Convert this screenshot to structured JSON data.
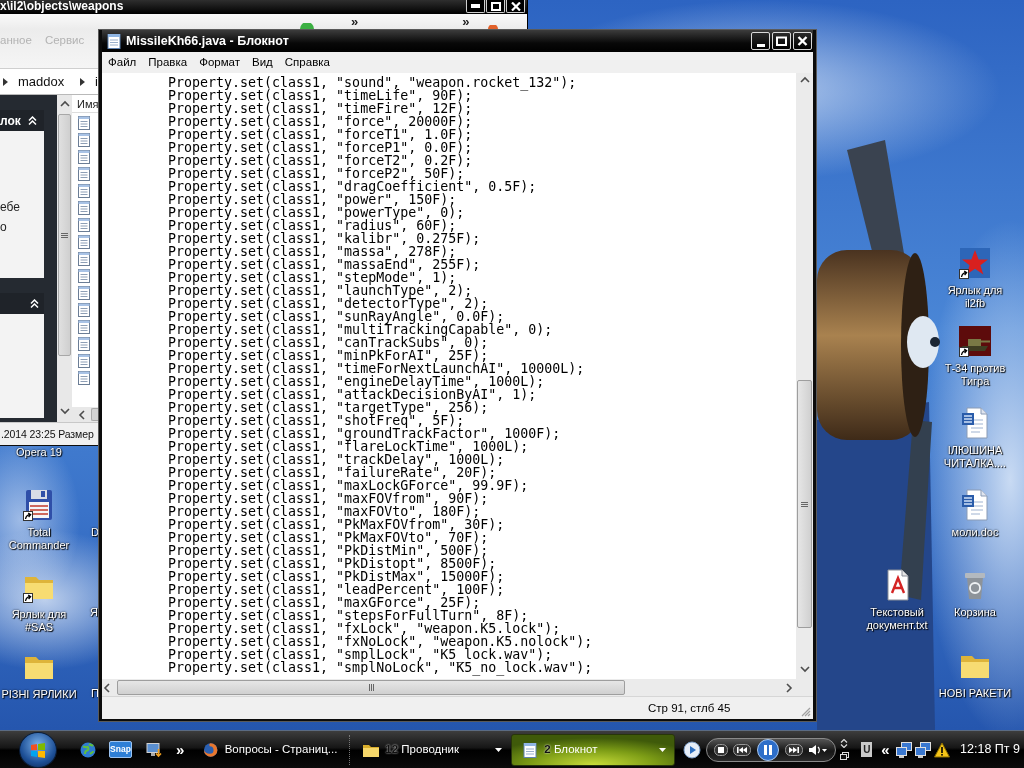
{
  "explorer_window": {
    "title": "x\\il2\\objects\\weapons",
    "toolbar_chevrons": [
      "»",
      "»"
    ],
    "menu": [
      "анное",
      "Сервис"
    ],
    "breadcrumb": [
      "maddox",
      "i"
    ],
    "task_panels": [
      {
        "title": "лок",
        "expanded": true,
        "lines": [
          "ебе",
          "о"
        ]
      },
      {
        "expanded": true
      }
    ],
    "file_list": {
      "column": "Имя"
    },
    "status": ".2014 23:25 Размер"
  },
  "notepad_window": {
    "title": "MissileKh66.java - Блокнот",
    "menu": [
      "Файл",
      "Правка",
      "Формат",
      "Вид",
      "Справка"
    ],
    "lines": [
      "Property.set(class1, \"sound\", \"weapon.rocket_132\");",
      "Property.set(class1, \"timeLife\", 90F);",
      "Property.set(class1, \"timeFire\", 12F);",
      "Property.set(class1, \"force\", 20000F);",
      "Property.set(class1, \"forceT1\", 1.0F);",
      "Property.set(class1, \"forceP1\", 0.0F);",
      "Property.set(class1, \"forceT2\", 0.2F);",
      "Property.set(class1, \"forceP2\", 50F);",
      "Property.set(class1, \"dragCoefficient\", 0.5F);",
      "Property.set(class1, \"power\", 150F);",
      "Property.set(class1, \"powerType\", 0);",
      "Property.set(class1, \"radius\", 60F);",
      "Property.set(class1, \"kalibr\", 0.275F);",
      "Property.set(class1, \"massa\", 278F);",
      "Property.set(class1, \"massaEnd\", 255F);",
      "Property.set(class1, \"stepMode\", 1);",
      "Property.set(class1, \"launchType\", 2);",
      "Property.set(class1, \"detectorType\", 2);",
      "Property.set(class1, \"sunRayAngle\", 0.0F);",
      "Property.set(class1, \"multiTrackingCapable\", 0);",
      "Property.set(class1, \"canTrackSubs\", 0);",
      "Property.set(class1, \"minPkForAI\", 25F);",
      "Property.set(class1, \"timeForNextLaunchAI\", 10000L);",
      "Property.set(class1, \"engineDelayTime\", 1000L);",
      "Property.set(class1, \"attackDecisionByAI\", 1);",
      "Property.set(class1, \"targetType\", 256);",
      "Property.set(class1, \"shotFreq\", 5F);",
      "Property.set(class1, \"groundTrackFactor\", 1000F);",
      "Property.set(class1, \"flareLockTime\", 1000L);",
      "Property.set(class1, \"trackDelay\", 1000L);",
      "Property.set(class1, \"failureRate\", 20F);",
      "Property.set(class1, \"maxLockGForce\", 99.9F);",
      "Property.set(class1, \"maxFOVfrom\", 90F);",
      "Property.set(class1, \"maxFOVto\", 180F);",
      "Property.set(class1, \"PkMaxFOVfrom\", 30F);",
      "Property.set(class1, \"PkMaxFOVto\", 70F);",
      "Property.set(class1, \"PkDistMin\", 500F);",
      "Property.set(class1, \"PkDistopt\", 8500F);",
      "Property.set(class1, \"PkDistMax\", 15000F);",
      "Property.set(class1, \"leadPercent\", 100F);",
      "Property.set(class1, \"maxGForce\", 25F);",
      "Property.set(class1, \"stepsForFullTurn\", 8F);",
      "Property.set(class1, \"fxLock\", \"weapon.K5.lock\");",
      "Property.set(class1, \"fxNoLock\", \"weapon.K5.nolock\");",
      "Property.set(class1, \"smplLock\", \"K5_lock.wav\");",
      "Property.set(class1, \"smplNoLock\", \"K5_no_lock.wav\");"
    ],
    "status": "Стр 91, стлб 45"
  },
  "desktop_icons": [
    {
      "label": "Opera 19",
      "kind": "none"
    },
    {
      "label": "Total Commander",
      "kind": "floppy",
      "shortcut": true
    },
    {
      "label": "Ярлык для #SAS",
      "kind": "folder",
      "shortcut": true
    },
    {
      "label": "РІЗНІ ЯРЛИКИ",
      "kind": "folder",
      "shortcut": false
    },
    {
      "label": "D",
      "kind": "none"
    },
    {
      "label": "Я",
      "kind": "none"
    },
    {
      "label": "П",
      "kind": "none"
    },
    {
      "label": "Ярлык для il2fb",
      "kind": "star",
      "shortcut": true
    },
    {
      "label": "Т-34 против Тигра",
      "kind": "tank",
      "shortcut": true
    },
    {
      "label": "ІЛЮШИНА ЧИТАЛКА....",
      "kind": "word",
      "shortcut": false
    },
    {
      "label": "моли.doc",
      "kind": "word",
      "shortcut": false
    },
    {
      "label": "Текстовый документ.txt",
      "kind": "text",
      "shortcut": false
    },
    {
      "label": "Корзина",
      "kind": "bin",
      "shortcut": false
    },
    {
      "label": "НОВІ РАКЕТИ",
      "kind": "folder",
      "shortcut": false
    }
  ],
  "taskbar": {
    "quick_launch": {
      "label": "Snap",
      "more": "»"
    },
    "tasks": [
      {
        "kind": "browser",
        "label": "Вопросы - Страниц...",
        "selected": false,
        "grouped": false
      },
      {
        "kind": "folder",
        "count": "12",
        "label": "Проводник",
        "selected": false,
        "grouped": true
      },
      {
        "kind": "notepad",
        "count": "2",
        "label": "Блокнот",
        "selected": true,
        "grouped": true
      }
    ],
    "media_player": {
      "playing": true
    },
    "tray": {
      "tag": "U",
      "more": "«",
      "clock": "12:18 Пт 9"
    }
  }
}
